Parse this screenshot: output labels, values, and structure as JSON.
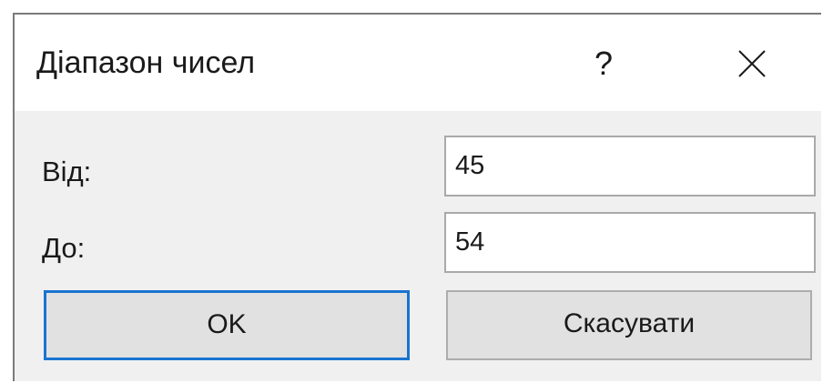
{
  "window": {
    "title": "Діапазон чисел",
    "help_label": "?",
    "close_icon": "close-icon"
  },
  "form": {
    "from_label": "Від:",
    "from_value": "45",
    "to_label": "До:",
    "to_value": "54"
  },
  "buttons": {
    "ok_label": "OK",
    "cancel_label": "Скасувати"
  },
  "colors": {
    "titlebar": "#ffffff",
    "body": "#f0f0f0",
    "default_button_border": "#1874d0",
    "button_face": "#e1e1e1"
  }
}
